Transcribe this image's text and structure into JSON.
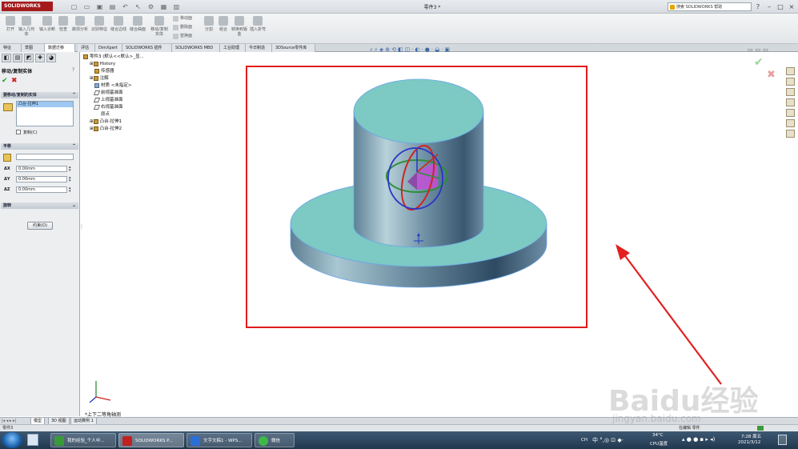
{
  "app": {
    "logo_text": "SOLIDWORKS",
    "doc_title": "零件3 *",
    "help_search_placeholder": "搜索 SOLIDWORKS 帮助"
  },
  "toolbar": {
    "buttons": [
      {
        "label": "打开",
        "icon": "open-icon"
      },
      {
        "label": "输入几何体",
        "icon": "import-geometry-icon"
      },
      {
        "label": "输入诊断",
        "icon": "import-diagnostics-icon"
      },
      {
        "label": "检查",
        "icon": "check-icon"
      },
      {
        "label": "跳现分析",
        "icon": "analysis-icon"
      },
      {
        "label": "识别特征",
        "icon": "feature-recognition-icon"
      },
      {
        "label": "缝合边线",
        "icon": "stitch-edge-icon"
      },
      {
        "label": "缝合曲面",
        "icon": "knit-surface-icon"
      },
      {
        "label": "移动/复制实体",
        "icon": "move-copy-icon"
      }
    ],
    "small_items": [
      "移动面",
      "删除面",
      "替换面"
    ],
    "buttons2": [
      {
        "label": "分割",
        "icon": "split-icon"
      },
      {
        "label": "组合",
        "icon": "combine-icon"
      },
      {
        "label": "转换到钣金",
        "icon": "convert-sheetmetal-icon"
      },
      {
        "label": "插入折弯",
        "icon": "insert-bend-icon"
      }
    ]
  },
  "ribbon_tabs": [
    "特征",
    "草图",
    "数据迁移",
    "评估",
    "DimXpert",
    "SOLIDWORKS 插件",
    "SOLIDWORKS MBD",
    "工业助理",
    "今日制造",
    "3DSource零件库"
  ],
  "property_manager": {
    "title": "移动/复制实体",
    "ok_icon": "checkmark-icon",
    "cancel_icon": "cross-icon",
    "group_bodies": {
      "label": "要移动/复制的实体",
      "selected_body": "凸台-拉伸1",
      "copy_label": "复制(C)"
    },
    "group_translate": {
      "label": "平移",
      "dx_label": "ΔX",
      "dx": "0.00mm",
      "dy_label": "ΔY",
      "dy": "0.00mm",
      "dz_label": "ΔZ",
      "dz": "0.00mm"
    },
    "group_rotate": {
      "label": "旋转"
    },
    "constraints_button": "约束(O)"
  },
  "feature_tree": {
    "root": "零件3 (默认<<默认>_显...",
    "items": [
      "History",
      "传感器",
      "注解",
      "材质 <未指定>",
      "前视基准面",
      "上视基准面",
      "右视基准面",
      "原点",
      "凸台-拉伸1",
      "凸台-拉伸2"
    ]
  },
  "viewport": {
    "view_name": "*上下二等角轴测",
    "highlight_color": "#e01b1b",
    "model_color": "#7dc9c4"
  },
  "bottom_tabs": [
    "模型",
    "3D 视图",
    "运动算例 1"
  ],
  "status_bar": {
    "doc_name": "零件3",
    "status_text": "在编辑 零件"
  },
  "taskbar": {
    "items": [
      "我的经验_个人中...",
      "SOLIDWORKS P...",
      "文字文稿1 - WPS...",
      "微信"
    ],
    "tray": {
      "ime": "CH",
      "temp": "34°C",
      "cpu": "CPU温度",
      "time": "7:28 周五",
      "date": "2021/3/12"
    }
  },
  "watermark": {
    "brand": "Baidu经验",
    "url": "jingyan.baidu.com"
  }
}
